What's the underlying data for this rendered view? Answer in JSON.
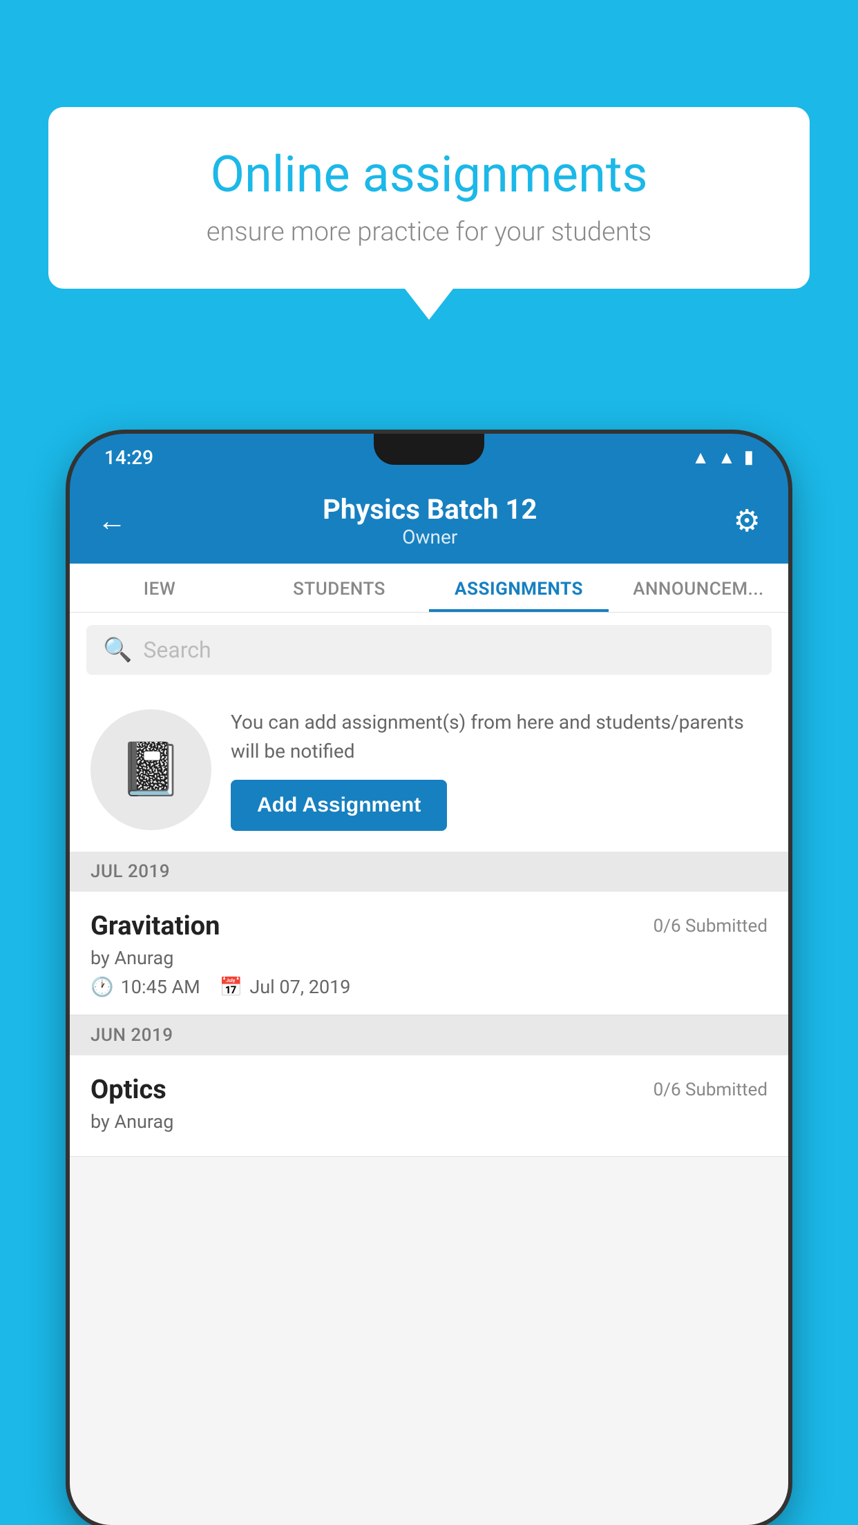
{
  "background_color": "#1BB8E8",
  "speech_bubble": {
    "title": "Online assignments",
    "subtitle": "ensure more practice for your students"
  },
  "status_bar": {
    "time": "14:29",
    "icons": [
      "wifi",
      "signal",
      "battery"
    ]
  },
  "app_header": {
    "title": "Physics Batch 12",
    "subtitle": "Owner",
    "back_label": "←",
    "settings_label": "⚙"
  },
  "tabs": [
    {
      "label": "IEW",
      "active": false
    },
    {
      "label": "STUDENTS",
      "active": false
    },
    {
      "label": "ASSIGNMENTS",
      "active": true
    },
    {
      "label": "ANNOUNCEM...",
      "active": false
    }
  ],
  "search": {
    "placeholder": "Search"
  },
  "add_assignment_card": {
    "description": "You can add assignment(s) from here and students/parents will be notified",
    "button_label": "Add Assignment"
  },
  "sections": [
    {
      "label": "JUL 2019",
      "assignments": [
        {
          "name": "Gravitation",
          "submitted": "0/6 Submitted",
          "by": "by Anurag",
          "time": "10:45 AM",
          "date": "Jul 07, 2019"
        }
      ]
    },
    {
      "label": "JUN 2019",
      "assignments": [
        {
          "name": "Optics",
          "submitted": "0/6 Submitted",
          "by": "by Anurag",
          "time": "",
          "date": ""
        }
      ]
    }
  ]
}
